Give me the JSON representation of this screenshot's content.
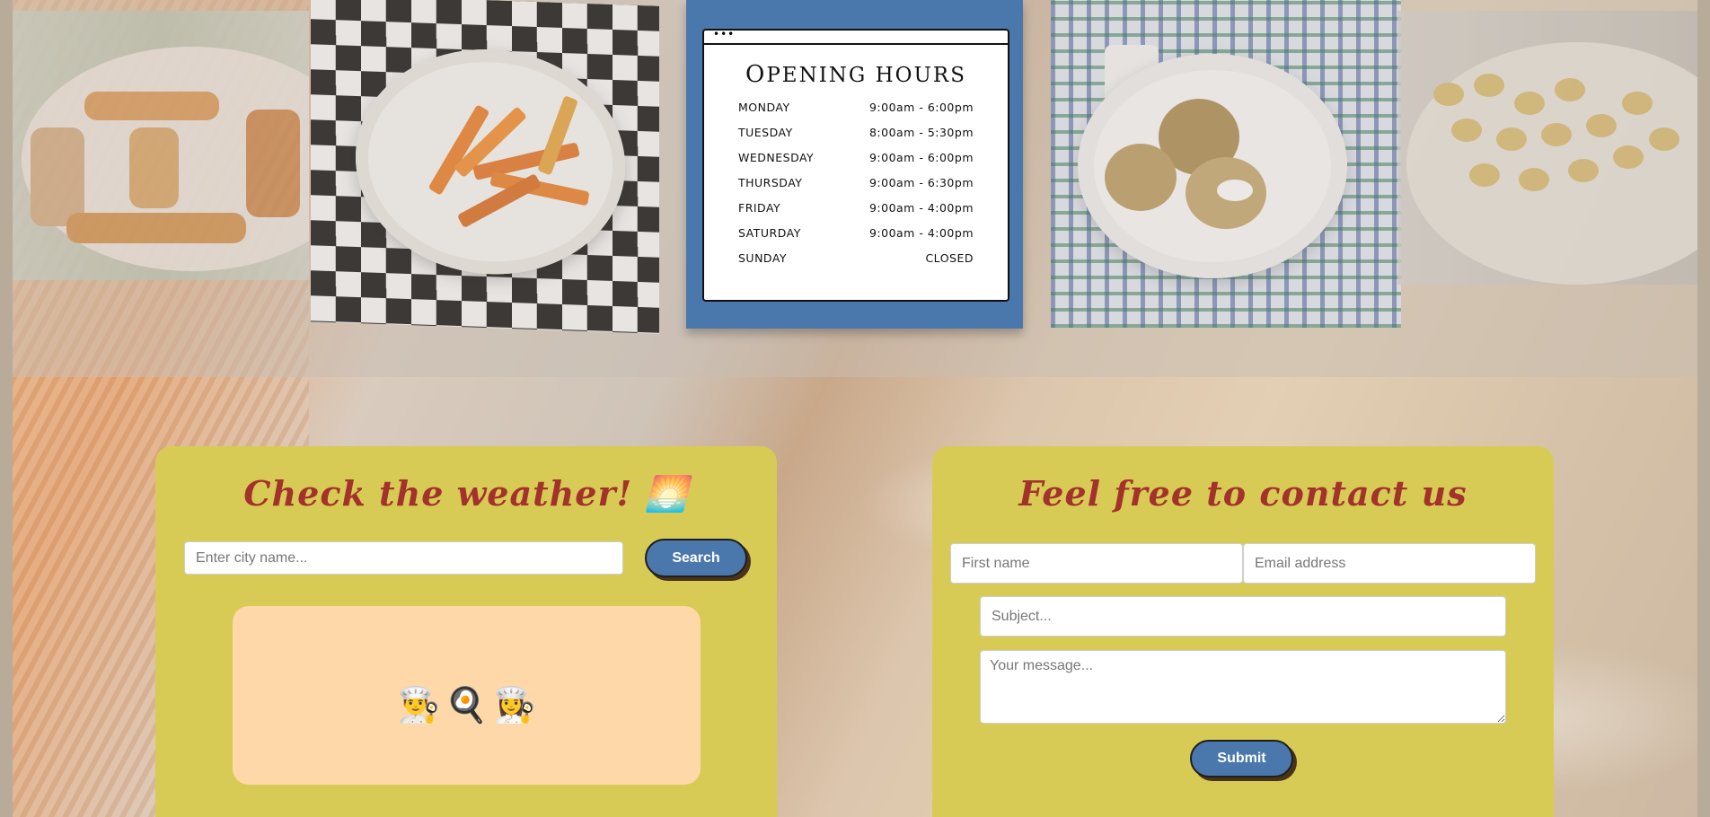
{
  "opening_hours": {
    "title": "Opening Hours",
    "window_dots": "•••",
    "days": [
      {
        "day": "MONDAY",
        "hours": "9:00am - 6:00pm"
      },
      {
        "day": "TUESDAY",
        "hours": "8:00am - 5:30pm"
      },
      {
        "day": "WEDNESDAY",
        "hours": "9:00am - 6:00pm"
      },
      {
        "day": "THURSDAY",
        "hours": "9:00am - 6:30pm"
      },
      {
        "day": "FRIDAY",
        "hours": "9:00am - 4:00pm"
      },
      {
        "day": "SATURDAY",
        "hours": "9:00am - 4:00pm"
      },
      {
        "day": "SUNDAY",
        "hours": "CLOSED"
      }
    ]
  },
  "gallery": {
    "photos": [
      "pastries-photo",
      "fries-photo",
      "dumplings-photo",
      "gnocchi-photo"
    ]
  },
  "weather": {
    "title": "Check the weather! 🌅",
    "city_placeholder": "Enter city name...",
    "search_label": "Search",
    "result_emojis": [
      "👨‍🍳",
      "🍳",
      "👩‍🍳"
    ]
  },
  "contact": {
    "title": "Feel free to contact us",
    "first_name_placeholder": "First name",
    "email_placeholder": "Email address",
    "subject_placeholder": "Subject...",
    "message_placeholder": "Your message...",
    "submit_label": "Submit"
  },
  "colors": {
    "panel": "#d8cb55",
    "accent_blue": "#4a78ad",
    "title_red": "#a3322c",
    "result_box": "#fed8a8"
  }
}
